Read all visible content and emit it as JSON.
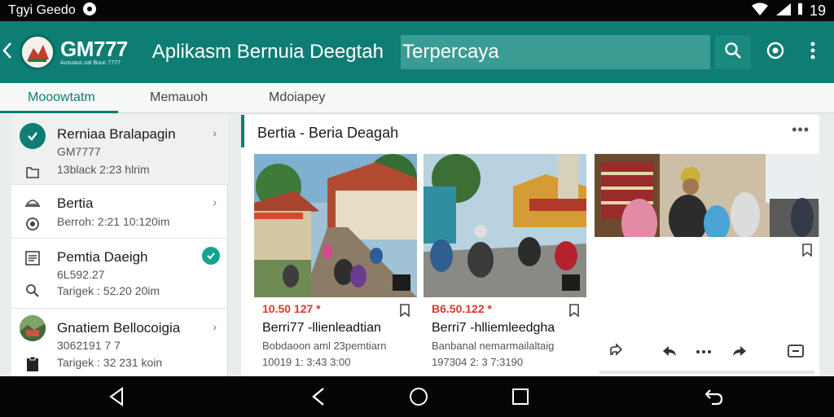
{
  "status_bar": {
    "left_text": "Tgyi Geedo",
    "time": "19"
  },
  "app_bar": {
    "brand": "GM777",
    "brand_tagline": "Ausuauc.oal Buuc 7777",
    "title": "Aplikasm Bernuia Deegtah",
    "search_value": "Terpercaya",
    "accent_color": "#0e7d73"
  },
  "tabs": [
    {
      "label": "Mooowtatm",
      "active": true
    },
    {
      "label": "Memauoh",
      "active": false
    },
    {
      "label": "Mdoiapey",
      "active": false
    }
  ],
  "sidebar": {
    "items": [
      {
        "title": "Rerniaa Bralapagin",
        "sub1": "GM7777",
        "sub2": "13black 2:23 hlrim",
        "icon": "check-circle-icon",
        "sub_icon": "folder-icon",
        "selected": true
      },
      {
        "title": "Bertia",
        "sub1": "Berroh: 2:21 10:120im",
        "icon": "hat-icon",
        "sub_icon": "record-icon"
      },
      {
        "title": "Pemtia Daeigh",
        "sub1": "6L592.27",
        "sub2": "Tarigek : 52.20 20im",
        "icon": "list-icon",
        "sub_icon": "search-icon",
        "badge": "check-badge-icon"
      },
      {
        "title": "Gnatiem Bellocoigia",
        "sub1": "3062191 7 7",
        "sub2": "Tarigek : 32 231 koin",
        "icon": "avatar",
        "sub_icon": "clipboard-icon"
      }
    ]
  },
  "main": {
    "title": "Bertia - Beria Deagah",
    "cards": [
      {
        "price": "10.50 127 *",
        "title": "Berri77 -llienleadtian",
        "line1": "Bobdaoon aml 23pemtiarn",
        "line2": "10019 1: 3:43 3:00"
      },
      {
        "price": "B6.50.122 *",
        "title": "Berri7 -hlliemleedgha",
        "line1": "Banbanal nemarmailaltaig",
        "line2": "197304 2: 3 7:3190"
      },
      {
        "actions": [
          "share-icon",
          "reply-icon",
          "dots-icon",
          "forward-icon",
          "message-icon"
        ]
      }
    ]
  }
}
